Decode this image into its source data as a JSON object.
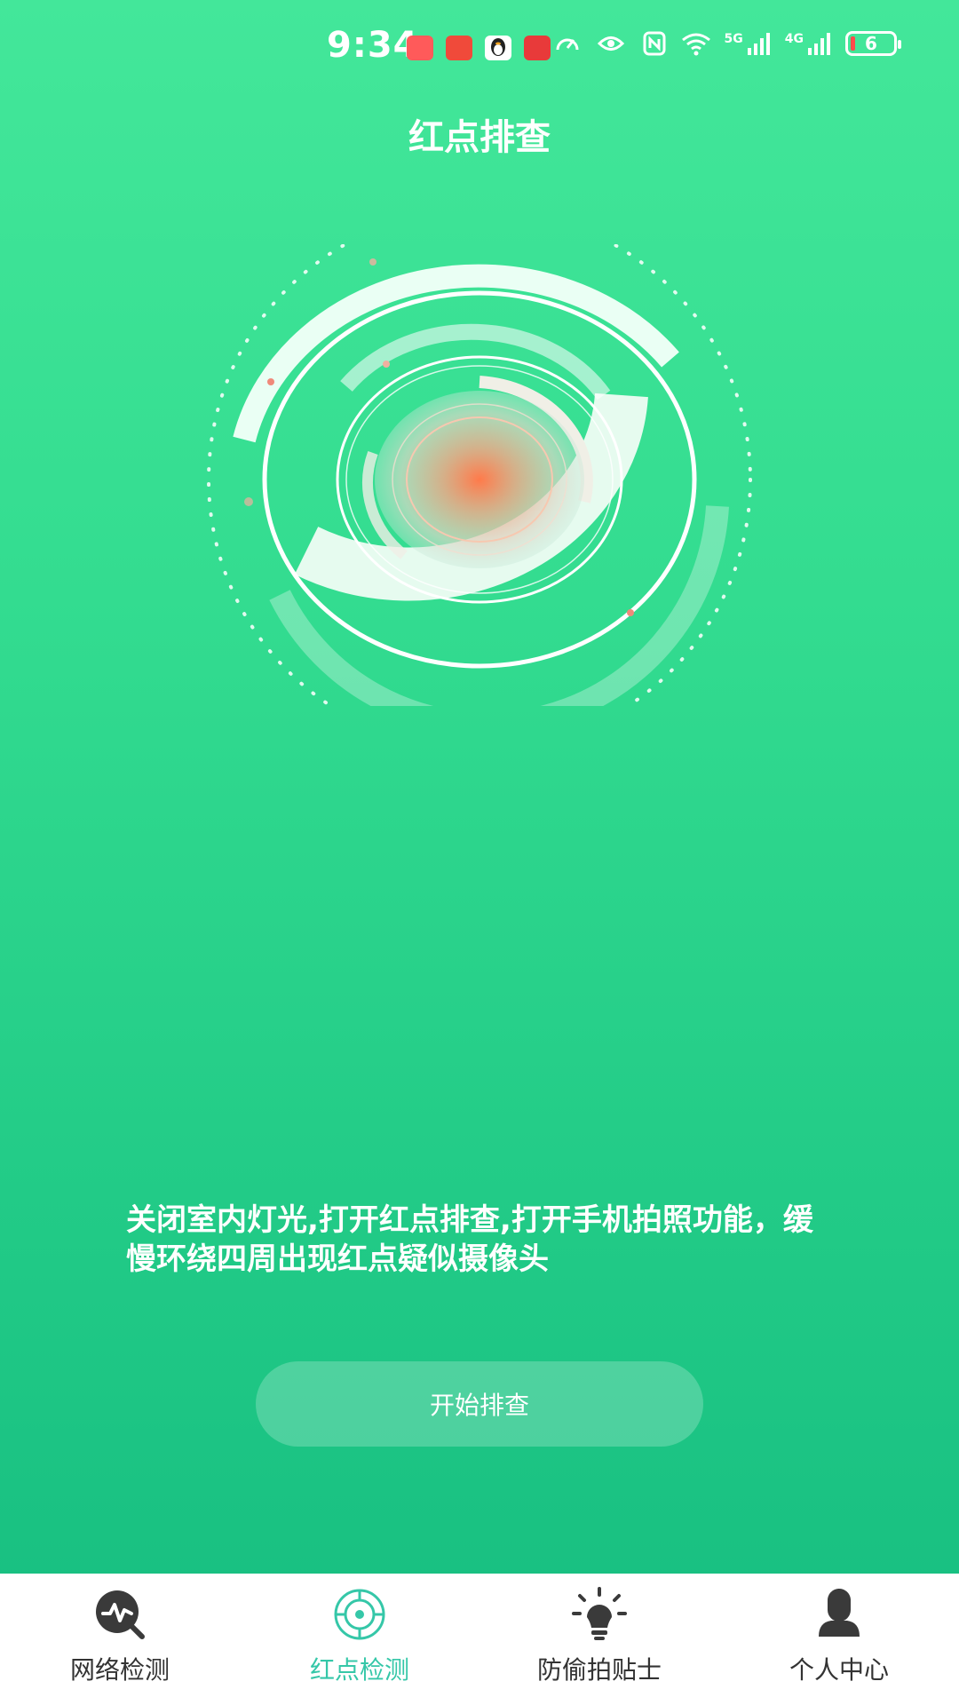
{
  "status_bar": {
    "time": "9:34",
    "battery_level": "6",
    "signal_5g": "5G",
    "signal_4g": "4G"
  },
  "header": {
    "title": "红点排查"
  },
  "main": {
    "instruction": "关闭室内灯光,打开红点排查,打开手机拍照功能，缓慢环绕四周出现红点疑似摄像头",
    "start_button": "开始排查"
  },
  "bottom_nav": {
    "items": [
      {
        "label": "网络检测",
        "icon": "network-check-icon"
      },
      {
        "label": "红点检测",
        "icon": "red-dot-target-icon"
      },
      {
        "label": "防偷拍贴士",
        "icon": "lightbulb-icon"
      },
      {
        "label": "个人中心",
        "icon": "person-icon"
      }
    ],
    "active_index": 1
  },
  "colors": {
    "background_top": "#43e79a",
    "background_bottom": "#16bd80",
    "active_tab": "#35c7a8",
    "inactive_tab": "#333333",
    "icon_dark": "#3a3a3a"
  }
}
